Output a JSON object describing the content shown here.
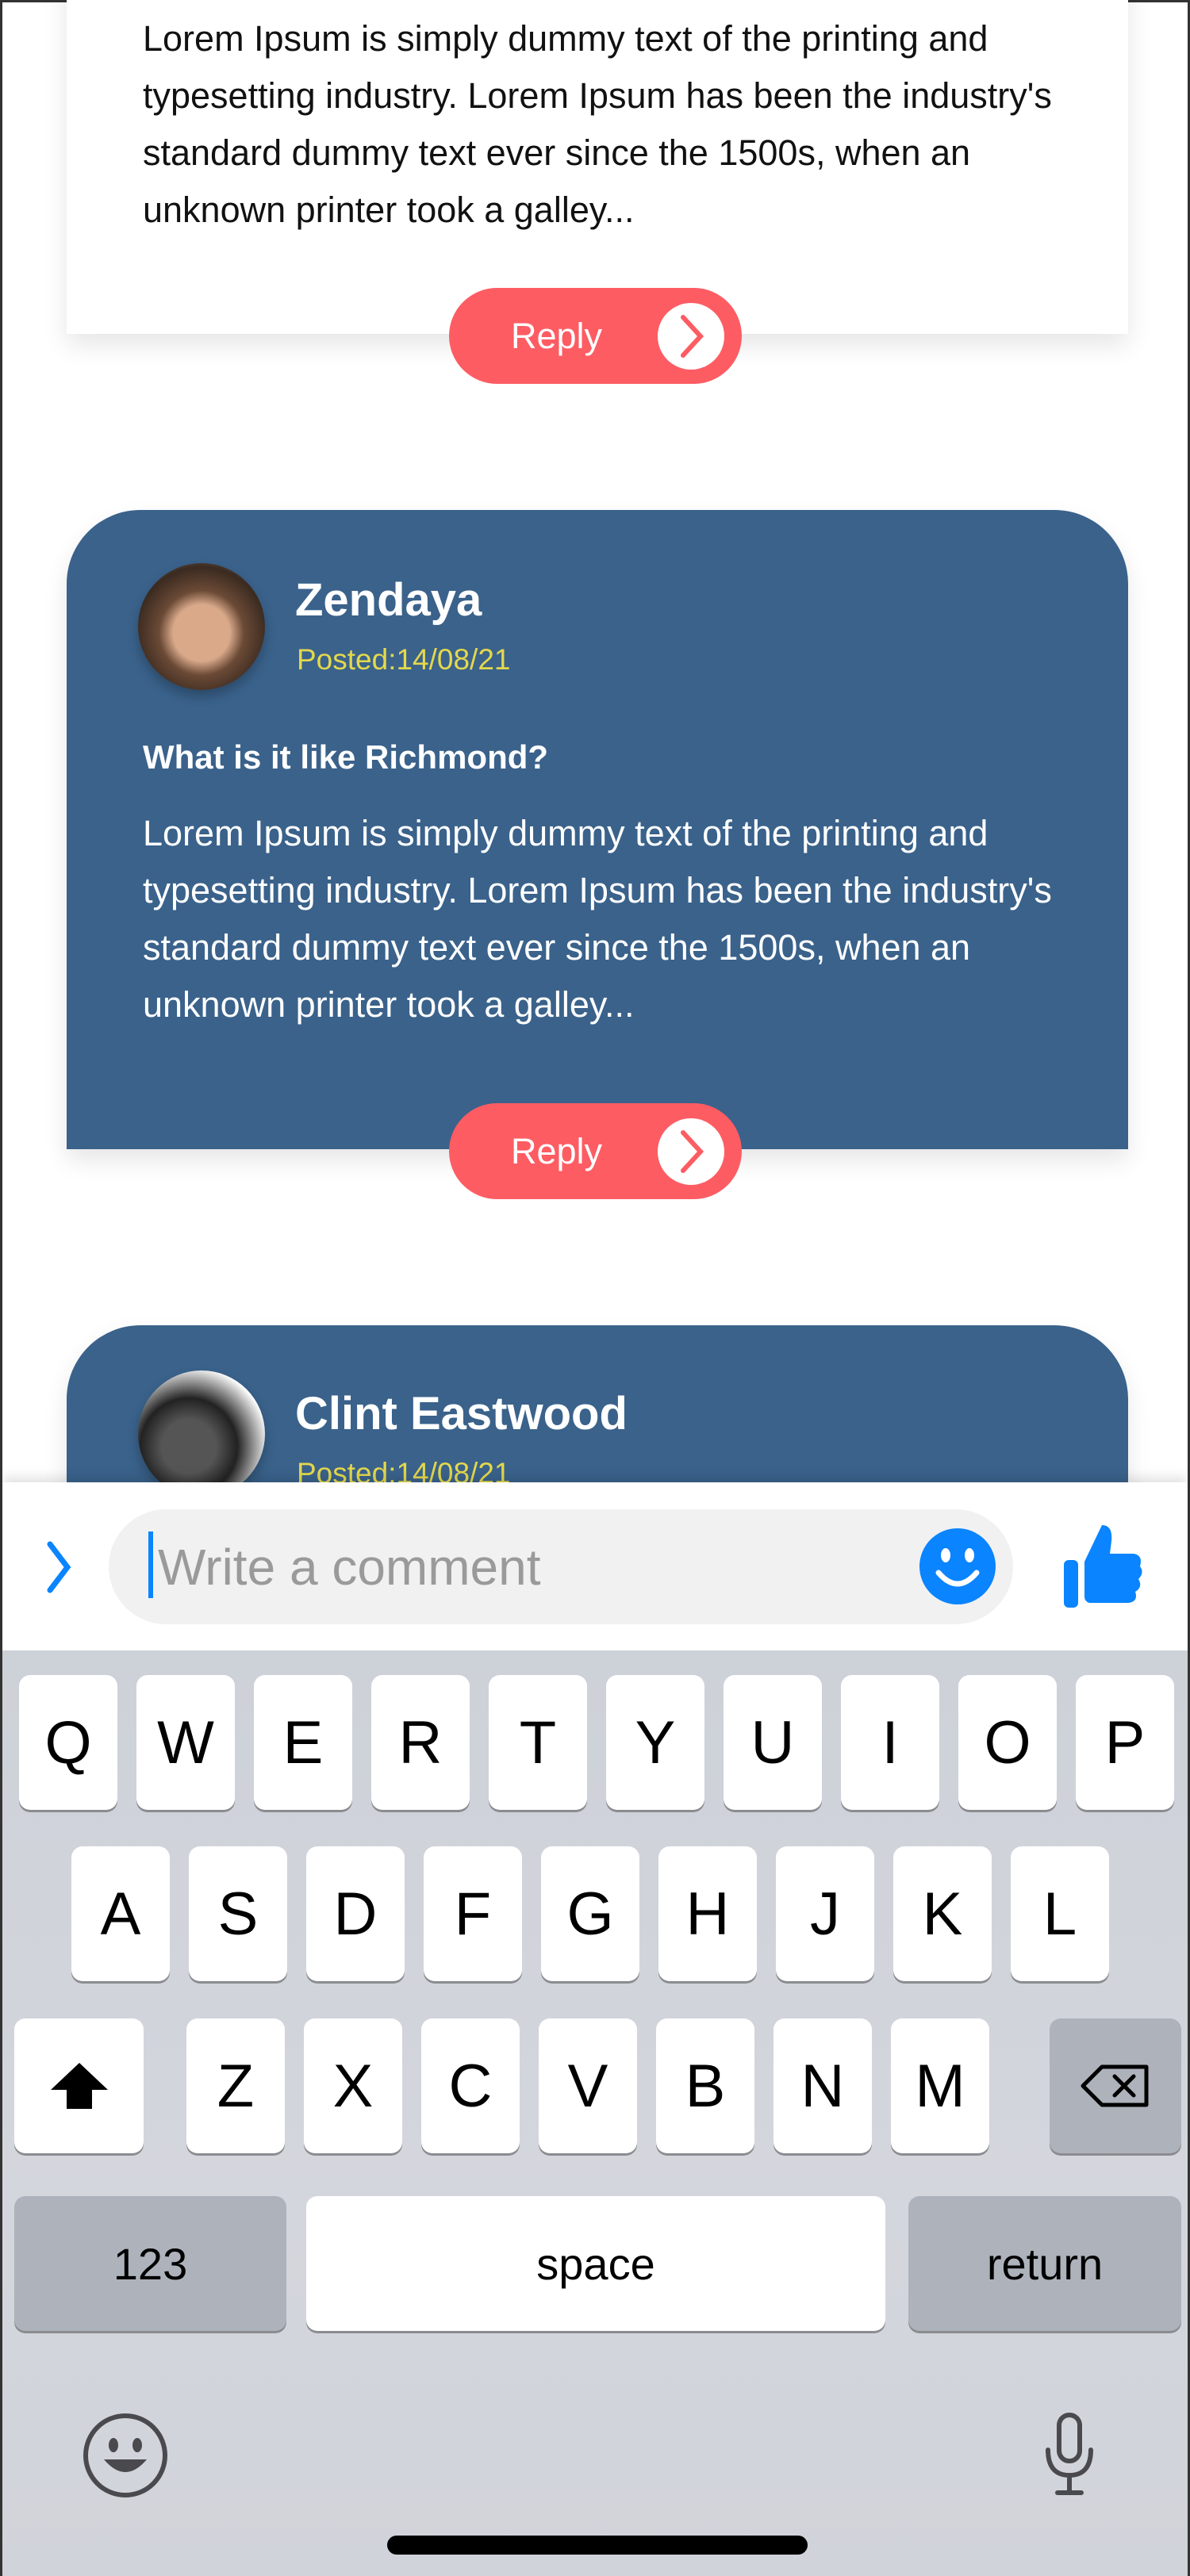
{
  "posts": [
    {
      "body": "Lorem Ipsum is simply dummy text of the printing and typesetting industry. Lorem Ipsum has been the industry's standard dummy text ever since the 1500s, when an unknown printer took a galley...",
      "reply": "Reply"
    },
    {
      "author": "Zendaya",
      "posted": "Posted:14/08/21",
      "title": "What is it like Richmond?",
      "body": "Lorem Ipsum is simply dummy text of the printing and typesetting industry. Lorem Ipsum has been the industry's standard dummy text ever since the 1500s, when an unknown printer took a galley...",
      "reply": "Reply"
    },
    {
      "author": "Clint Eastwood",
      "posted": "Posted:14/08/21"
    }
  ],
  "comment": {
    "placeholder": "Write a comment",
    "icons": [
      "chevron-right-icon",
      "smiley-icon",
      "thumbs-up-icon"
    ],
    "accent": "#0a84ff"
  },
  "colors": {
    "card": "#3a628b",
    "reply": "#fd5c63",
    "posted": "#e4d84c"
  },
  "keyboard": {
    "row1": [
      "Q",
      "W",
      "E",
      "R",
      "T",
      "Y",
      "U",
      "I",
      "O",
      "P"
    ],
    "row2": [
      "A",
      "S",
      "D",
      "F",
      "G",
      "H",
      "J",
      "K",
      "L"
    ],
    "row3": [
      "Z",
      "X",
      "C",
      "V",
      "B",
      "N",
      "M"
    ],
    "numbers": "123",
    "space": "space",
    "return": "return"
  }
}
